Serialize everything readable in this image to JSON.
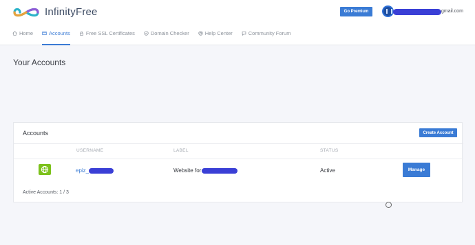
{
  "brand": {
    "name": "InfinityFree"
  },
  "header": {
    "premium_label": "Go Premium",
    "user_email_visible": "gmail.com"
  },
  "nav": {
    "items": [
      {
        "label": "Home",
        "icon": "home-icon"
      },
      {
        "label": "Accounts",
        "icon": "accounts-icon",
        "active": true
      },
      {
        "label": "Free SSL Certificates",
        "icon": "lock-icon"
      },
      {
        "label": "Domain Checker",
        "icon": "check-circle-icon"
      },
      {
        "label": "Help Center",
        "icon": "lifebuoy-icon"
      },
      {
        "label": "Community Forum",
        "icon": "chat-icon"
      }
    ]
  },
  "page": {
    "title": "Your Accounts"
  },
  "accounts_card": {
    "title": "Accounts",
    "create_label": "Create Account",
    "columns": {
      "username": "USERNAME",
      "label": "LABEL",
      "status": "STATUS"
    },
    "rows": [
      {
        "icon": "globe-icon",
        "username_prefix": "epiz_",
        "label_prefix": "Website for",
        "status": "Active",
        "manage_label": "Manage"
      }
    ],
    "footer": "Active Accounts: 1 / 3"
  },
  "colors": {
    "accent": "#3a7bd5",
    "site_icon": "#7cc11b",
    "redaction": "#3a3fd6"
  }
}
